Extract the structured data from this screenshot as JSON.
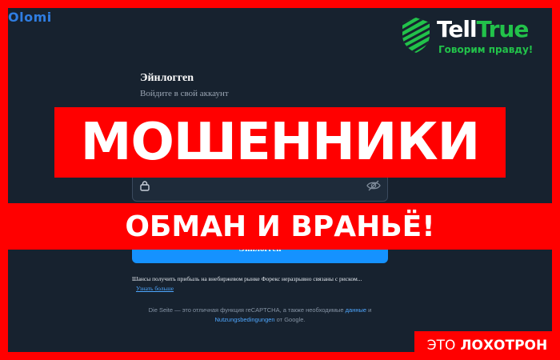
{
  "brand": {
    "logo_text": "Olomi"
  },
  "login": {
    "title": "Эйнлоггеn",
    "subtitle": "Войдите в свой аккаунт",
    "password_placeholder": "",
    "submit_label": "Эйнлоггеn"
  },
  "disclaimer": {
    "risk_text": "Шансы получить прибыль на внебиржевом рынке Форекс неразрывно связаны с риском...",
    "more_link": "Узнать больше",
    "recaptcha_prefix": "Die Seite — это отличная функция reCAPTCHA, а также необходимые",
    "recaptcha_link1": "данные",
    "recaptcha_and": "и",
    "recaptcha_link2": "Nutzungsbedingungen",
    "recaptcha_suffix": "от Google."
  },
  "overlay": {
    "main_banner": "МОШЕННИКИ",
    "sub_banner": "ОБМАН И ВРАНЬЁ!",
    "badge_prefix": "ЭТО",
    "badge_strong": "ЛОХОТРОН"
  },
  "telltrue": {
    "name_white": "Tell",
    "name_green": "True",
    "slogan": "Говорим правду!"
  },
  "icons": {
    "lock": "lock-icon",
    "eye": "eye-off-icon",
    "shield": "shield-icon"
  },
  "colors": {
    "frame": "#ff0000",
    "background": "#17222f",
    "button": "#1592ff",
    "link": "#4ea7ff",
    "telltrue_green": "#22c24a"
  }
}
